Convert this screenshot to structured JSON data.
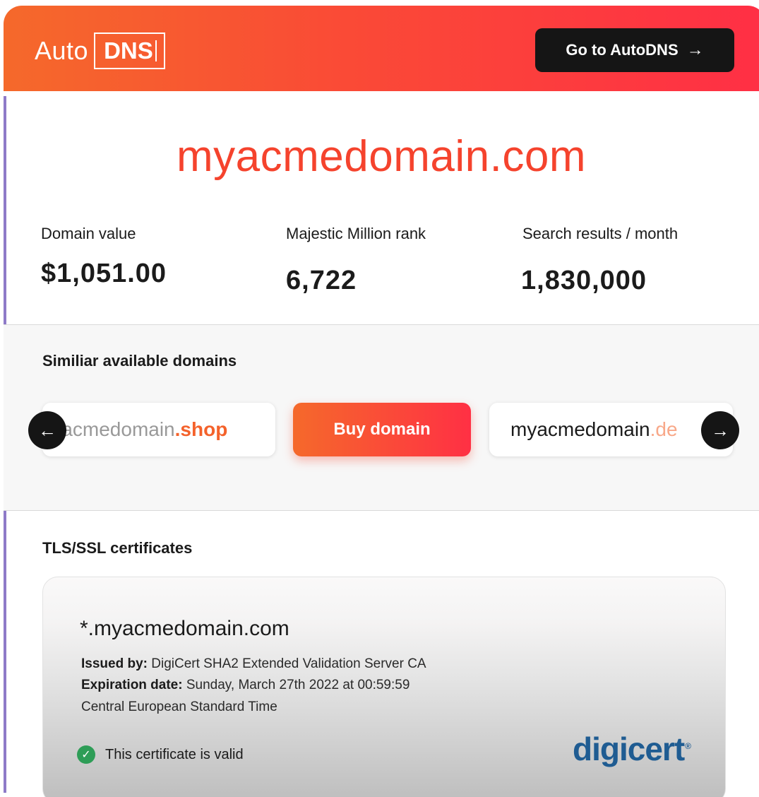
{
  "header": {
    "logo_prefix": "Auto",
    "logo_brand": "DNS",
    "goto_label": "Go to AutoDNS",
    "goto_icon": "→"
  },
  "domain": "myacmedomain.com",
  "stats": [
    {
      "label": "Domain value",
      "value": "$1,051.00"
    },
    {
      "label": "Majestic Million rank",
      "value": "6,722"
    },
    {
      "label": "Search results / month",
      "value": "1,830,000"
    }
  ],
  "similar": {
    "title": "Similiar available domains",
    "left": {
      "name": "myacmedomain",
      "tld": ".shop"
    },
    "buy_label": "Buy domain",
    "right": {
      "name": "myacmedomain",
      "tld": ".de"
    },
    "prev_icon": "←",
    "next_icon": "→"
  },
  "tls": {
    "title": "TLS/SSL certificates",
    "cert_domain": "*.myacmedomain.com",
    "issued_label": "Issued by:",
    "issued_value": "DigiCert SHA2 Extended Validation Server CA",
    "expiration_label": "Expiration date:",
    "expiration_value": "Sunday, March 27th 2022 at 00:59:59",
    "timezone": "Central European Standard Time",
    "valid_text": "This certificate is valid",
    "issuer_logo": "digicert"
  },
  "colors": {
    "accent": "#f5432d",
    "header_gradient_start": "#f5692b",
    "header_gradient_end": "#ff2f45",
    "valid_green": "#2e9d57",
    "digicert_blue": "#1f5c92"
  }
}
